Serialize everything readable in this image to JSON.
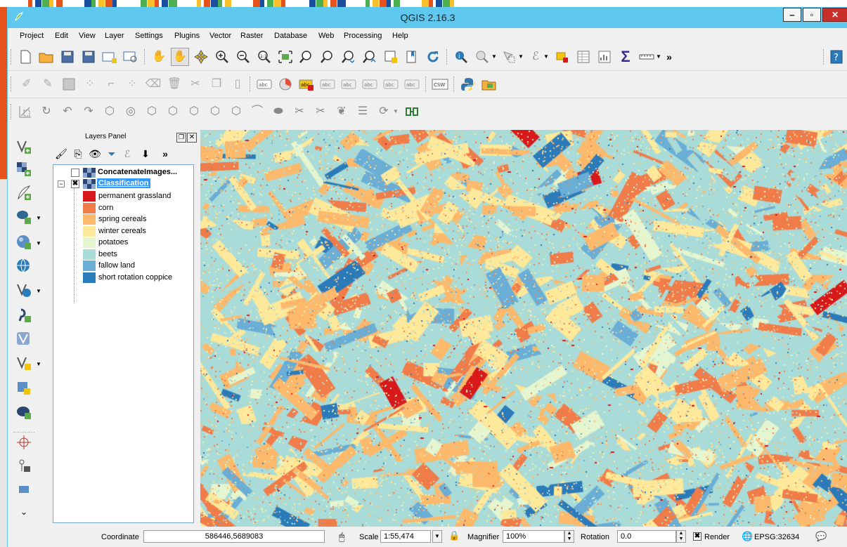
{
  "window": {
    "title": "QGIS 2.16.3"
  },
  "menu": [
    "Project",
    "Edit",
    "View",
    "Layer",
    "Settings",
    "Plugins",
    "Vector",
    "Raster",
    "Database",
    "Web",
    "Processing",
    "Help"
  ],
  "icons": {
    "app": "qgis-logo-icon",
    "overflow": "»"
  },
  "layers_panel": {
    "title": "Layers Panel",
    "layers": [
      {
        "name": "ConcatenateImages...",
        "checked": false,
        "expanded": false
      },
      {
        "name": "Classification",
        "checked": true,
        "expanded": true,
        "selected": true
      }
    ],
    "legend": [
      {
        "label": "permanent grassland",
        "color": "#d7191c"
      },
      {
        "label": "corn",
        "color": "#f07c4a"
      },
      {
        "label": "spring cereals",
        "color": "#fdb96b"
      },
      {
        "label": "winter cereals",
        "color": "#fee89a"
      },
      {
        "label": "potatoes",
        "color": "#e5f5d0"
      },
      {
        "label": "beets",
        "color": "#a9dcd8"
      },
      {
        "label": "fallow land",
        "color": "#6aaed6"
      },
      {
        "label": "short rotation coppice",
        "color": "#2b7bba"
      }
    ]
  },
  "statusbar": {
    "coordinate_label": "Coordinate",
    "coordinate_value": "586446,5689083",
    "scale_label": "Scale",
    "scale_value": "1:55,474",
    "magnifier_label": "Magnifier",
    "magnifier_value": "100%",
    "rotation_label": "Rotation",
    "rotation_value": "0.0",
    "render_label": "Render",
    "render_checked": true,
    "crs_label": "EPSG:32634"
  },
  "colors": {
    "titlebar": "#5fc8ef",
    "selection": "#3399ff"
  }
}
